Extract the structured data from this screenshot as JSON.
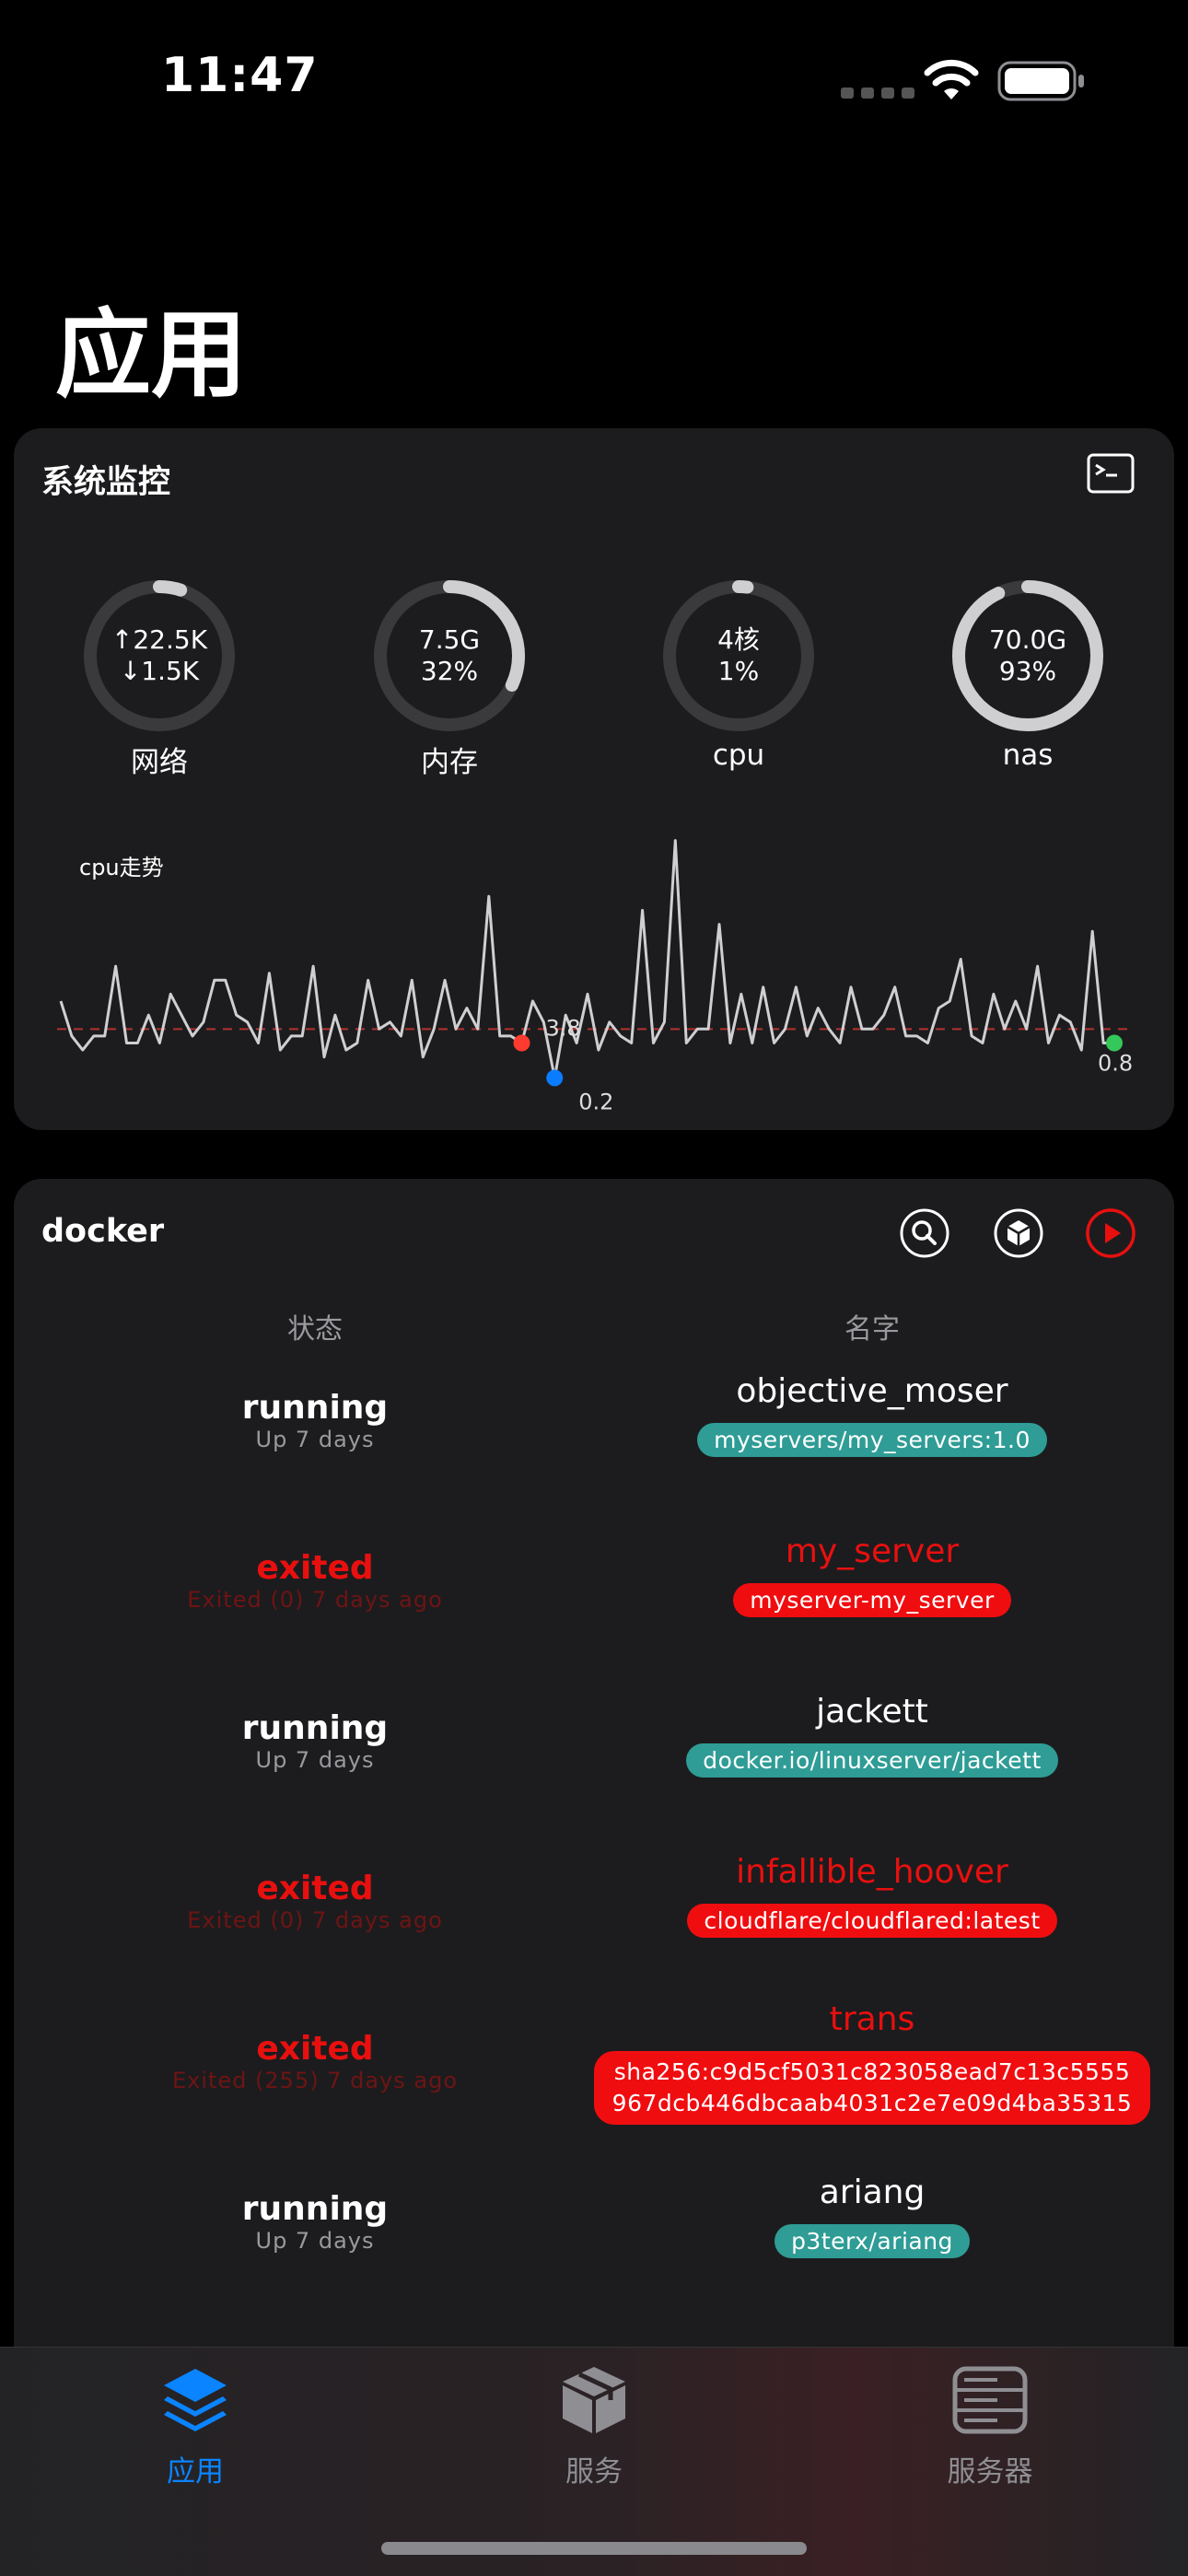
{
  "status_bar": {
    "time": "11:47"
  },
  "page_title": "应用",
  "system_monitor": {
    "title": "系统监控",
    "gauges": [
      {
        "label": "网络",
        "line1": "↑22.5K",
        "line2": "↓1.5K",
        "fraction": 0.05
      },
      {
        "label": "内存",
        "line1": "7.5G",
        "line2": "32%",
        "fraction": 0.32
      },
      {
        "label": "cpu",
        "line1": "4核",
        "line2": "1%",
        "fraction": 0.01
      },
      {
        "label": "nas",
        "line1": "70.0G",
        "line2": "93%",
        "fraction": 0.93
      }
    ],
    "cpu_trend": {
      "label": "cpu走势",
      "max_label": "3.8",
      "min_label": "0.2",
      "last_label": "0.8",
      "values": [
        1.4,
        0.9,
        0.7,
        0.9,
        0.9,
        1.9,
        0.8,
        0.8,
        1.2,
        0.8,
        1.5,
        1.2,
        0.9,
        1.1,
        1.7,
        1.7,
        1.2,
        1.1,
        0.8,
        1.8,
        0.7,
        0.9,
        0.9,
        1.9,
        0.6,
        1.2,
        0.7,
        0.8,
        1.7,
        1.0,
        1.1,
        0.9,
        1.7,
        0.6,
        1.0,
        1.7,
        1.0,
        1.3,
        1.0,
        2.9,
        0.9,
        0.9,
        0.8,
        1.4,
        1.1,
        0.3,
        1.2,
        0.8,
        1.5,
        0.7,
        1.1,
        0.9,
        0.8,
        2.7,
        0.8,
        1.1,
        3.7,
        0.8,
        1.0,
        1.0,
        2.5,
        0.8,
        1.5,
        0.8,
        1.6,
        0.8,
        1.0,
        1.6,
        0.9,
        1.3,
        1.0,
        0.8,
        1.6,
        1.0,
        1.0,
        1.2,
        1.6,
        0.9,
        0.9,
        0.8,
        1.3,
        1.4,
        2.0,
        0.9,
        0.8,
        1.5,
        1.0,
        1.4,
        1.0,
        1.9,
        0.8,
        1.2,
        1.1,
        0.7,
        2.4,
        0.8,
        0.8
      ],
      "max_index": 42,
      "min_index": 45,
      "avg": 1.0,
      "colors": {
        "line": "#cfcfd1",
        "avg": "#b3322f",
        "max": "#ff3b30",
        "min": "#0a7cff",
        "last": "#34c759"
      }
    }
  },
  "docker": {
    "title": "docker",
    "headers": {
      "status": "状态",
      "name": "名字"
    },
    "rows": [
      {
        "state": "running",
        "detail": "Up 7 days",
        "name": "objective_moser",
        "image": "myservers/my_servers:1.0",
        "ok": true
      },
      {
        "state": "exited",
        "detail": "Exited (0) 7 days ago",
        "name": "my_server",
        "image": "myserver-my_server",
        "ok": false
      },
      {
        "state": "running",
        "detail": "Up 7 days",
        "name": "jackett",
        "image": "docker.io/linuxserver/jackett",
        "ok": true
      },
      {
        "state": "exited",
        "detail": "Exited (0) 7 days ago",
        "name": "infallible_hoover",
        "image": "cloudflare/cloudflared:latest",
        "ok": false
      },
      {
        "state": "exited",
        "detail": "Exited (255) 7 days ago",
        "name": "trans",
        "image_line1": "sha256:c9d5cf5031c823058ead7c13c5555",
        "image_line2": "967dcb446dbcaab4031c2e7e09d4ba35315",
        "ok": false
      },
      {
        "state": "running",
        "detail": "Up 7 days",
        "name": "ariang",
        "image": "p3terx/ariang",
        "ok": true
      }
    ]
  },
  "tabbar": {
    "tabs": [
      {
        "label": "应用",
        "active": true
      },
      {
        "label": "服务",
        "active": false
      },
      {
        "label": "服务器",
        "active": false
      }
    ],
    "active_color": "#0a84ff",
    "inactive_color": "#8e8e93"
  }
}
